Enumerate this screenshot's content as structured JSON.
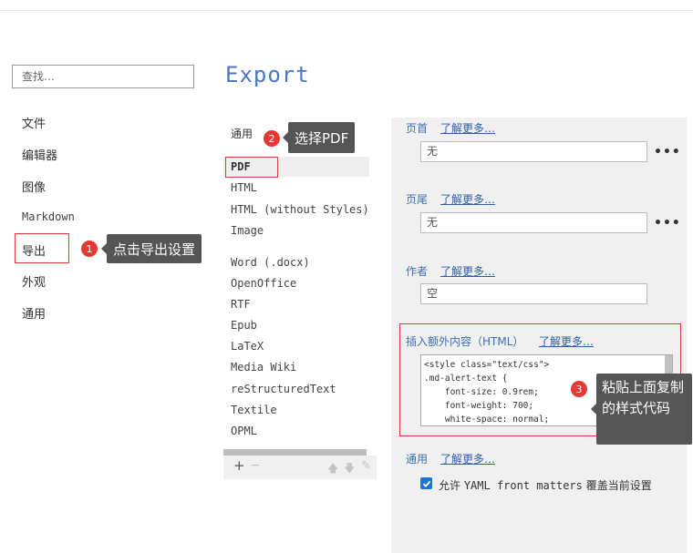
{
  "search": {
    "placeholder": "查找…"
  },
  "sidebar": {
    "items": [
      {
        "label": "文件"
      },
      {
        "label": "编辑器"
      },
      {
        "label": "图像"
      },
      {
        "label": "Markdown"
      },
      {
        "label": "导出"
      },
      {
        "label": "外观"
      },
      {
        "label": "通用"
      }
    ]
  },
  "page": {
    "title": "Export"
  },
  "formats": {
    "header": "通用",
    "group1": [
      "PDF",
      "HTML",
      "HTML (without Styles)",
      "Image"
    ],
    "group2": [
      "Word (.docx)",
      "OpenOffice",
      "RTF",
      "Epub",
      "LaTeX",
      "Media Wiki",
      "reStructuredText",
      "Textile",
      "OPML"
    ],
    "footer_icons": {
      "add": "+",
      "remove": "−",
      "up": "🡅",
      "down": "🡇",
      "edit": "✎"
    }
  },
  "settings": {
    "header": {
      "label": "页首",
      "learn": "了解更多…",
      "value": "无"
    },
    "footer": {
      "label": "页尾",
      "learn": "了解更多…",
      "value": "无"
    },
    "author": {
      "label": "作者",
      "learn": "了解更多…",
      "value": "空"
    },
    "extra": {
      "label": "插入额外内容（HTML）",
      "learn": "了解更多…",
      "code": "<style class=\"text/css\">\n.md-alert-text {\n    font-size: 0.9rem;\n    font-weight: 700;\n    white-space: normal;"
    },
    "general": {
      "label": "通用",
      "learn": "了解更多…",
      "yaml_pre": "允许 ",
      "yaml_mono": "YAML front matters",
      "yaml_post": " 覆盖当前设置",
      "checked": true
    },
    "more_icon": "•••"
  },
  "annotations": [
    {
      "num": "1",
      "text": "点击导出设置"
    },
    {
      "num": "2",
      "text": "选择PDF"
    },
    {
      "num": "3",
      "text": "粘贴上面复制的样式代码"
    }
  ],
  "colors": {
    "accent": "#4a78c2",
    "link": "#2f5ea8",
    "marker": "#e53935",
    "callout": "#555555"
  }
}
